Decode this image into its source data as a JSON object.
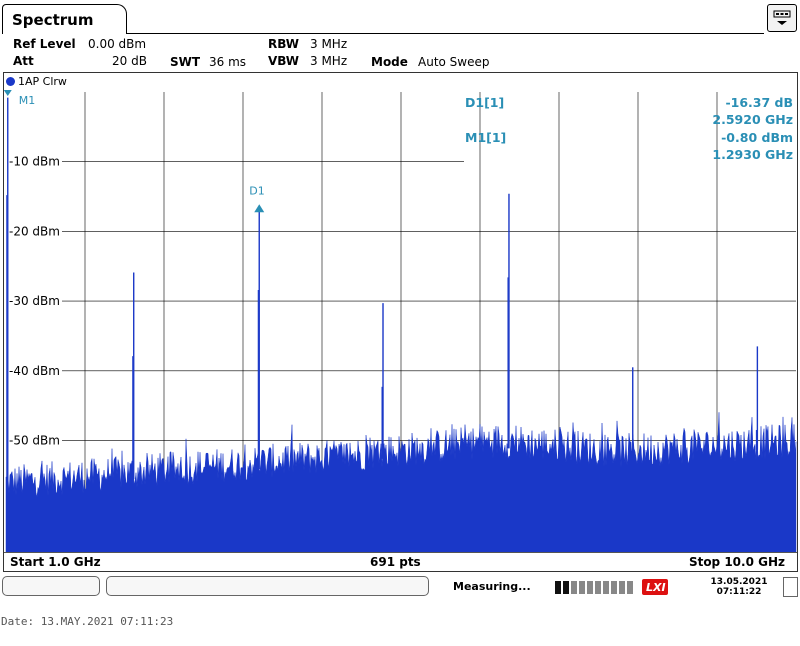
{
  "window": {
    "title": "Spectrum"
  },
  "params": {
    "ref_level_label": "Ref Level",
    "ref_level_value": "0.00 dBm",
    "att_label": "Att",
    "att_value": "20 dB",
    "swt_label": "SWT",
    "swt_value": "36 ms",
    "rbw_label": "RBW",
    "rbw_value": "3 MHz",
    "vbw_label": "VBW",
    "vbw_value": "3 MHz",
    "mode_label": "Mode",
    "mode_value": "Auto Sweep"
  },
  "trace": {
    "label": "1AP Clrw",
    "color": "#1a38c8"
  },
  "markers": {
    "d1_name": "D1[1]",
    "d1_level": "-16.37 dB",
    "d1_freq": "2.5920 GHz",
    "m1_name": "M1[1]",
    "m1_level": "-0.80 dBm",
    "m1_freq": "1.2930 GHz",
    "m1_tag": "M1",
    "d1_tag": "D1",
    "text_color": "#2a8fb5"
  },
  "chart_data": {
    "type": "line",
    "x_unit": "GHz",
    "xlim": [
      1.0,
      10.0
    ],
    "ylim": [
      -66,
      0
    ],
    "y_tick_labels": [
      "-10 dBm",
      "-20 dBm",
      "-30 dBm",
      "-40 dBm",
      "-50 dBm"
    ],
    "y_tick_values": [
      -10,
      -20,
      -30,
      -40,
      -50
    ],
    "x_divisions": 10,
    "grid": true,
    "noise_floor": {
      "x": [
        1.0,
        3.0,
        5.0,
        6.6,
        8.0,
        10.0
      ],
      "y": [
        -57,
        -55,
        -53,
        -51,
        -52.5,
        -51
      ]
    },
    "spurs": [
      {
        "x": 1.02,
        "y": -0.8
      },
      {
        "x": 2.455,
        "y": -25.9
      },
      {
        "x": 3.885,
        "y": -16.4
      },
      {
        "x": 5.295,
        "y": -30.3
      },
      {
        "x": 6.73,
        "y": -14.6
      },
      {
        "x": 8.14,
        "y": -39.5
      },
      {
        "x": 9.56,
        "y": -36.5
      }
    ],
    "points": "691 pts",
    "start_label": "Start 1.0 GHz",
    "stop_label": "Stop 10.0 GHz"
  },
  "status": {
    "text": "Measuring...",
    "date": "13.05.2021",
    "time": "07:11:22",
    "progress": 0.15
  },
  "footer_date": "Date: 13.MAY.2021   07:11:23"
}
